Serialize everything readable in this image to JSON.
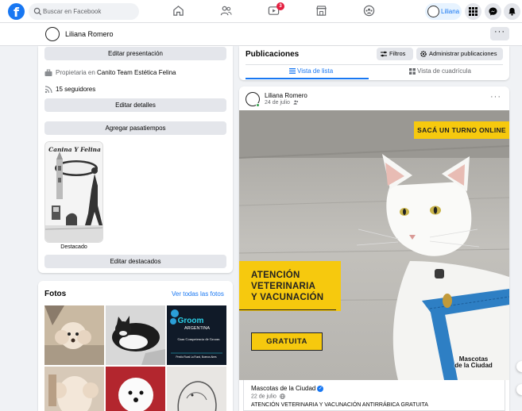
{
  "topbar": {
    "logo": "f",
    "search_placeholder": "Buscar en Facebook",
    "notification_badge": "3",
    "profile_name": "Liliana"
  },
  "profile_header": {
    "name": "Liliana Romero",
    "more": "···"
  },
  "intro": {
    "edit_presentation": "Editar presentación",
    "owner_prefix": "Propietaria en ",
    "owner_place": "Canito Team Estética Felina",
    "followers": "15 seguidores",
    "edit_details": "Editar detalles",
    "add_hobbies": "Agregar pasatiempos",
    "featured_caption": "Destacado",
    "edit_featured": "Editar destacados",
    "featured_logo_text": "Canina Y Felina"
  },
  "photos": {
    "title": "Fotos",
    "see_all": "Ver todas las fotos",
    "tile_text": [
      "Groom",
      "ARGENTINA",
      "Gran Competencia de Groom",
      "Predio Rural La Rural, Buenos Aires"
    ]
  },
  "publications": {
    "title": "Publicaciones",
    "filters": "Filtros",
    "manage": "Administrar publicaciones",
    "tab_list": "Vista de lista",
    "tab_grid": "Vista de cuadrícula"
  },
  "post": {
    "author": "Liliana Romero",
    "date": "24 de julio",
    "more": "···",
    "cta_tag": "SACÁ UN TURNO ONLINE",
    "promo_line1": "ATENCIÓN",
    "promo_line2": "VETERINARIA",
    "promo_line3": "Y VACUNACIÓN",
    "promo_free": "GRATUITA",
    "watermark_line1": "Mascotas",
    "watermark_line2": "de la Ciudad",
    "shared_author": "Mascotas de la Ciudad",
    "shared_date": "22 de julio",
    "shared_text": "ATENCIÓN VETERINARIA Y VACUNACIÓN ANTIRRÁBICA GRATUITA"
  },
  "colors": {
    "brand": "#1877f2",
    "page_bg": "#f0f2f5",
    "promo_yellow": "#f6c90e",
    "badge_red": "#e41e3f",
    "online_green": "#31a24c"
  },
  "icons": [
    "facebook-logo-icon",
    "search-icon",
    "home-icon",
    "friends-icon",
    "watch-icon",
    "marketplace-icon",
    "groups-icon",
    "menu-grid-icon",
    "messenger-icon",
    "bell-icon",
    "briefcase-icon",
    "rss-icon",
    "filter-icon",
    "gear-icon",
    "list-icon",
    "grid-icon",
    "friends-audience-icon",
    "globe-icon",
    "verified-icon"
  ]
}
